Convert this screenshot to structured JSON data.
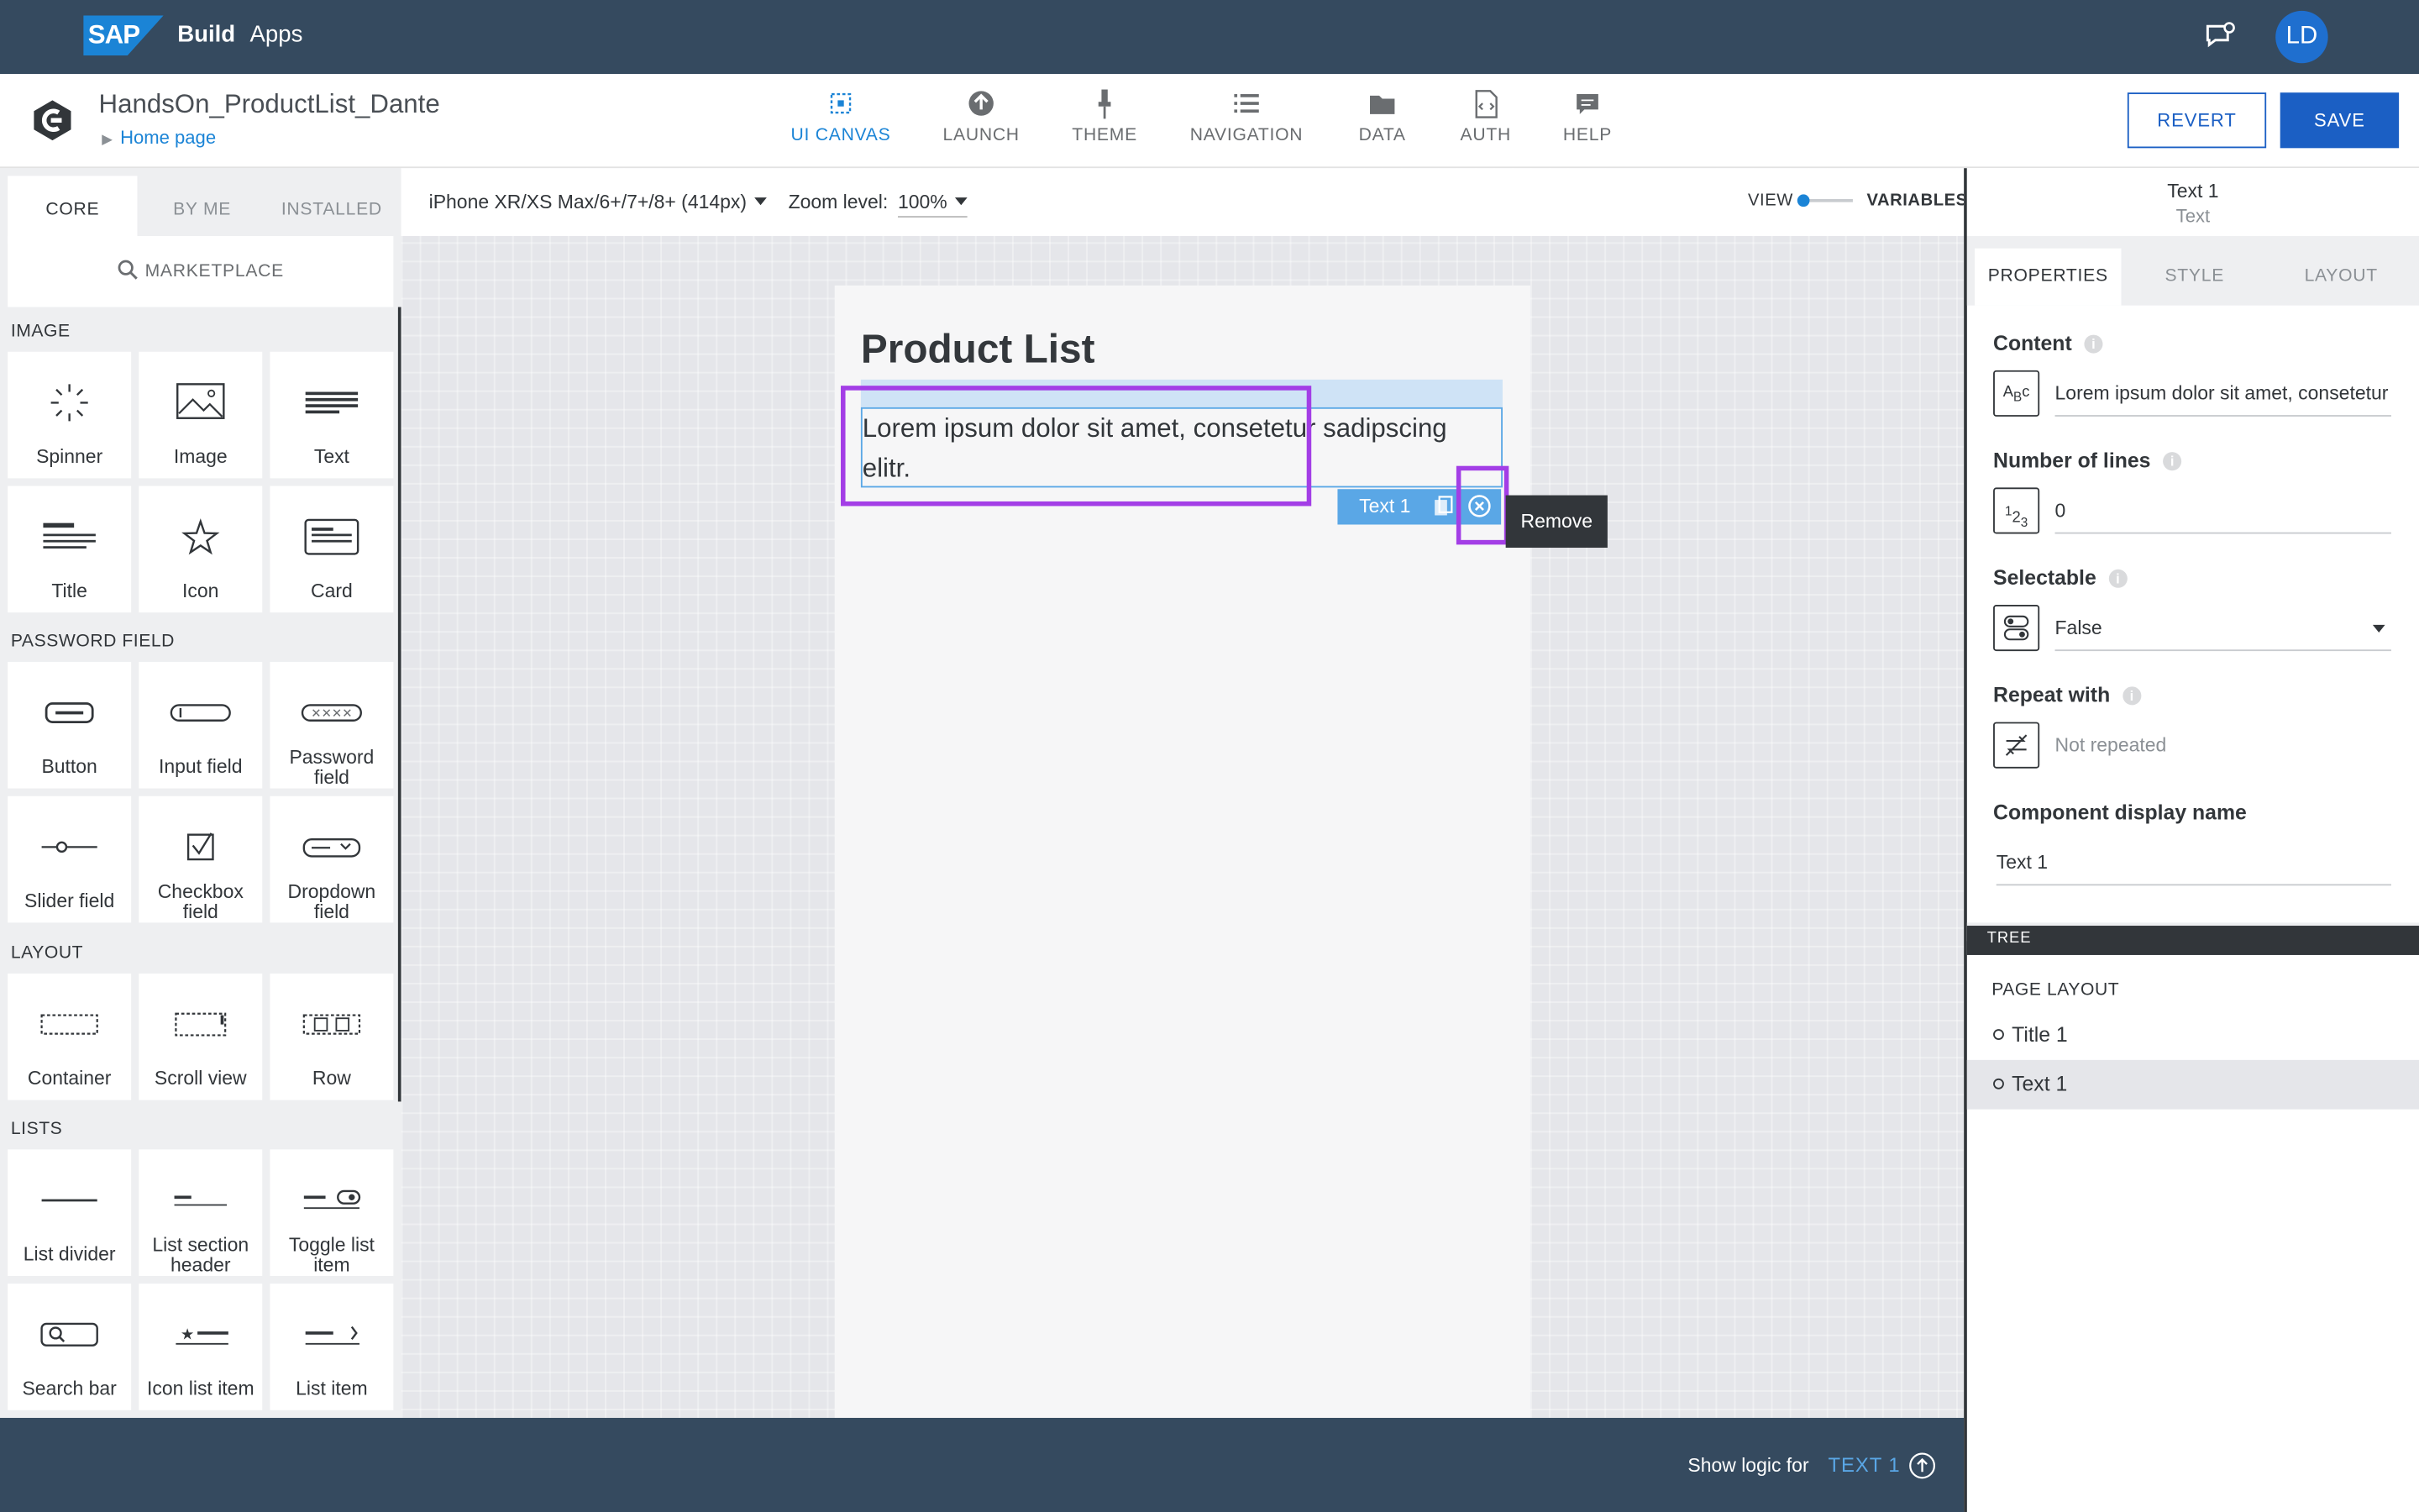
{
  "shell": {
    "logo": "SAP",
    "product": "Build",
    "section": "Apps",
    "avatar": "LD"
  },
  "app": {
    "project_title": "HandsOn_ProductList_Dante",
    "breadcrumb": "Home page",
    "nav": [
      {
        "label": "UI CANVAS",
        "icon": "ui-canvas-icon"
      },
      {
        "label": "LAUNCH",
        "icon": "launch-icon"
      },
      {
        "label": "THEME",
        "icon": "theme-brush-icon"
      },
      {
        "label": "NAVIGATION",
        "icon": "navigation-list-icon"
      },
      {
        "label": "DATA",
        "icon": "folder-icon"
      },
      {
        "label": "AUTH",
        "icon": "auth-code-icon"
      },
      {
        "label": "HELP",
        "icon": "help-chat-icon"
      }
    ],
    "revert": "REVERT",
    "save": "SAVE"
  },
  "left_panel": {
    "tabs": [
      "CORE",
      "BY ME",
      "INSTALLED"
    ],
    "marketplace": "MARKETPLACE",
    "sections": [
      "IMAGE",
      "PASSWORD FIELD",
      "LAYOUT",
      "LISTS"
    ],
    "components": [
      "Spinner",
      "Image",
      "Text",
      "Title",
      "Icon",
      "Card",
      "Button",
      "Input field",
      "Password field",
      "Slider field",
      "Checkbox field",
      "Dropdown field",
      "Container",
      "Scroll view",
      "Row",
      "List divider",
      "List section header",
      "Toggle list item",
      "Search bar",
      "Icon list item",
      "List item"
    ]
  },
  "canvas": {
    "device": "iPhone XR/XS Max/6+/7+/8+ (414px)",
    "zoom_label": "Zoom level:",
    "zoom_value": "100%",
    "view": "VIEW",
    "variables": "VARIABLES",
    "page_title": "Product List",
    "text_content": "Lorem ipsum dolor sit amet, consetetur sadipscing elitr.",
    "chip_label": "Text 1",
    "tooltip": "Remove",
    "highlight_color": "#a33ee6",
    "selection_color": "#5aa7e6"
  },
  "bottom": {
    "show_logic": "Show logic for",
    "target": "TEXT 1"
  },
  "right_panel": {
    "title": "Text 1",
    "subtitle": "Text",
    "tabs": [
      "PROPERTIES",
      "STYLE",
      "LAYOUT"
    ],
    "props": {
      "content_label": "Content",
      "content_value": "Lorem ipsum dolor sit amet, consetetur sadipscing elitr.",
      "lines_label": "Number of lines",
      "lines_value": "0",
      "selectable_label": "Selectable",
      "selectable_value": "False",
      "repeat_label": "Repeat with",
      "repeat_value": "Not repeated",
      "display_label": "Component display name",
      "display_value": "Text 1"
    },
    "tree_header": "TREE",
    "page_layout": "PAGE LAYOUT",
    "tree_items": [
      "Title 1",
      "Text 1"
    ]
  },
  "colors": {
    "shell": "#354a5f",
    "accent": "#1b84d6",
    "primary_button": "#1b5fc4"
  }
}
